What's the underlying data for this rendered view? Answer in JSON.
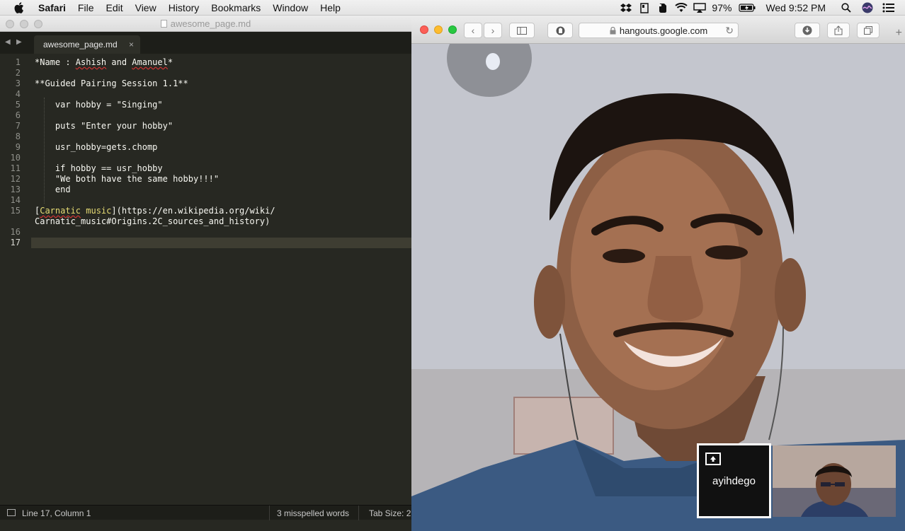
{
  "menubar": {
    "app": "Safari",
    "items": [
      "File",
      "Edit",
      "View",
      "History",
      "Bookmarks",
      "Window",
      "Help"
    ],
    "battery": "97%",
    "clock": "Wed 9:52 PM",
    "icons": [
      "dropbox-icon",
      "notes-icon",
      "evernote-icon",
      "wifi-icon",
      "airplay-icon",
      "battery-icon",
      "spotlight-icon",
      "siri-icon",
      "notification-center-icon"
    ]
  },
  "editor": {
    "window_title": "awesome_page.md",
    "tab_label": "awesome_page.md",
    "lines": [
      {
        "n": "1",
        "text": "*Name : Ashish and Amanuel*"
      },
      {
        "n": "2",
        "text": ""
      },
      {
        "n": "3",
        "text": "**Guided Pairing Session 1.1**"
      },
      {
        "n": "4",
        "text": ""
      },
      {
        "n": "5",
        "text": "    var hobby = \"Singing\""
      },
      {
        "n": "6",
        "text": ""
      },
      {
        "n": "7",
        "text": "    puts \"Enter your hobby\""
      },
      {
        "n": "8",
        "text": ""
      },
      {
        "n": "9",
        "text": "    usr_hobby=gets.chomp"
      },
      {
        "n": "10",
        "text": ""
      },
      {
        "n": "11",
        "text": "    if hobby == usr_hobby"
      },
      {
        "n": "12",
        "text": "    \"We both have the same hobby!!!\""
      },
      {
        "n": "13",
        "text": "    end"
      },
      {
        "n": "14",
        "text": ""
      },
      {
        "n": "15",
        "text": "[Carnatic music](https://en.wikipedia.org/wiki/"
      },
      {
        "n": "",
        "text": "Carnatic_music#Origins.2C_sources_and_history)"
      },
      {
        "n": "16",
        "text": ""
      },
      {
        "n": "17",
        "text": ""
      }
    ],
    "status": {
      "position": "Line 17, Column 1",
      "spelling": "3 misspelled words",
      "tab_size": "Tab Size: 2"
    }
  },
  "safari": {
    "address": "hangouts.google.com",
    "hangouts": {
      "participant_name": "ayihdego"
    }
  }
}
